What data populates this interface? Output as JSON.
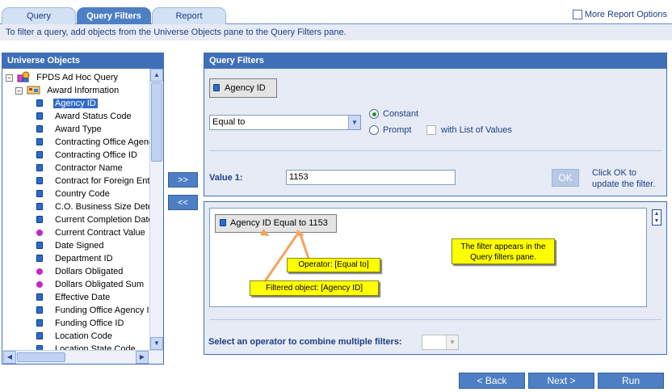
{
  "tabs": [
    {
      "label": "Query",
      "active": false
    },
    {
      "label": "Query Filters",
      "active": true
    },
    {
      "label": "Report",
      "active": false
    }
  ],
  "more_options_label": "More Report Options",
  "hint": "To filter a query, add objects from the Universe Objects pane to the Query Filters pane.",
  "universe": {
    "title": "Universe Objects",
    "root": "FPDS Ad Hoc Query",
    "folder": "Award Information",
    "items": [
      {
        "label": "Agency ID",
        "type": "dimension",
        "selected": true
      },
      {
        "label": "Award Status Code",
        "type": "dimension"
      },
      {
        "label": "Award Type",
        "type": "dimension"
      },
      {
        "label": "Contracting Office Agenc",
        "type": "dimension"
      },
      {
        "label": "Contracting Office ID",
        "type": "dimension"
      },
      {
        "label": "Contractor Name",
        "type": "dimension"
      },
      {
        "label": "Contract for Foreign Entit",
        "type": "dimension"
      },
      {
        "label": "Country Code",
        "type": "dimension"
      },
      {
        "label": "C.O. Business Size Dete",
        "type": "dimension"
      },
      {
        "label": "Current Completion Date",
        "type": "dimension"
      },
      {
        "label": "Current Contract Value",
        "type": "measure"
      },
      {
        "label": "Date Signed",
        "type": "dimension"
      },
      {
        "label": "Department ID",
        "type": "dimension"
      },
      {
        "label": "Dollars Obligated",
        "type": "measure"
      },
      {
        "label": "Dollars Obligated Sum",
        "type": "measure"
      },
      {
        "label": "Effective Date",
        "type": "dimension"
      },
      {
        "label": "Funding Office Agency II",
        "type": "dimension"
      },
      {
        "label": "Funding Office ID",
        "type": "dimension"
      },
      {
        "label": "Location Code",
        "type": "dimension"
      },
      {
        "label": "Location State Code",
        "type": "dimension"
      }
    ]
  },
  "arrows": {
    "add": ">>",
    "remove": "<<"
  },
  "filters": {
    "title": "Query Filters",
    "object_label": "Agency ID",
    "operator": "Equal to",
    "constant_label": "Constant",
    "prompt_label": "Prompt",
    "lov_label": "with List of Values",
    "value_label": "Value 1:",
    "value": "1153",
    "ok_label": "OK",
    "ok_hint_1": "Click OK to",
    "ok_hint_2": "update the filter."
  },
  "result": {
    "chip_label": "Agency ID Equal to 1153",
    "callout_filter": "The filter appears in the Query filters pane.",
    "callout_operator": "Operator: [Equal to]",
    "callout_object": "Filtered object: [Agency ID]",
    "combine_label": "Select an operator to combine multiple filters:"
  },
  "nav": {
    "back": "< Back",
    "next": "Next >",
    "run": "Run"
  },
  "colors": {
    "accent": "#3f6fb7",
    "panel_bg": "#e6ebf5",
    "callout": "#ffff00",
    "button": "#4e7fc4"
  }
}
